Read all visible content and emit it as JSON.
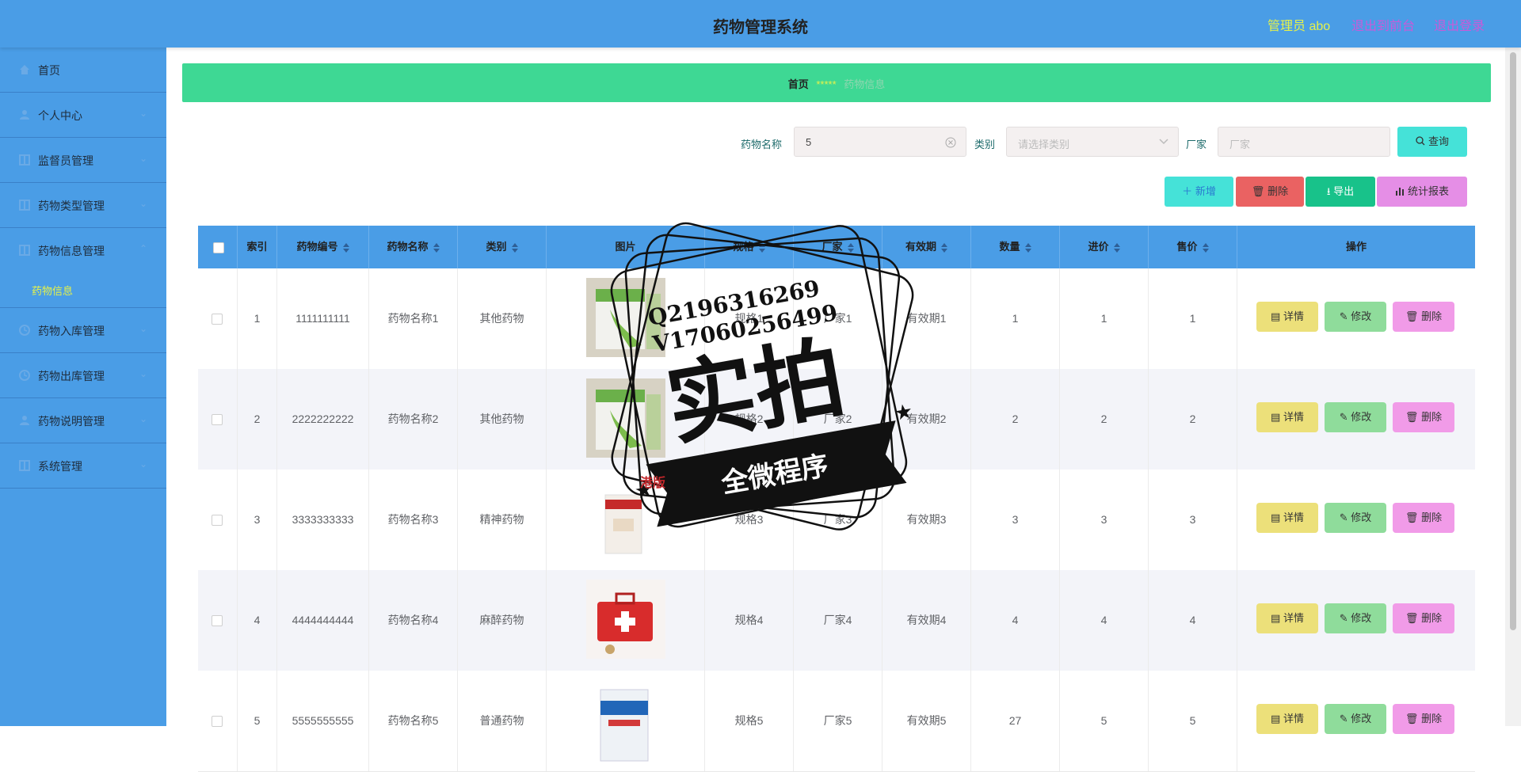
{
  "header": {
    "title": "药物管理系统",
    "admin": "管理员 abo",
    "back_to_front": "退出到前台",
    "logout": "退出登录"
  },
  "sidebar": {
    "items": [
      {
        "label": "首页",
        "icon": "home-icon",
        "chevron": ""
      },
      {
        "label": "个人中心",
        "icon": "user-icon",
        "chevron": "⌄"
      },
      {
        "label": "监督员管理",
        "icon": "grid-icon",
        "chevron": "⌄"
      },
      {
        "label": "药物类型管理",
        "icon": "grid-icon",
        "chevron": "⌄"
      },
      {
        "label": "药物信息管理",
        "icon": "grid-icon",
        "chevron": "⌃"
      },
      {
        "label": "药物入库管理",
        "icon": "clock-icon",
        "chevron": "⌄"
      },
      {
        "label": "药物出库管理",
        "icon": "clock-icon",
        "chevron": "⌄"
      },
      {
        "label": "药物说明管理",
        "icon": "user-icon",
        "chevron": "⌄"
      },
      {
        "label": "系统管理",
        "icon": "grid-icon",
        "chevron": "⌄"
      }
    ],
    "sub_item": "药物信息"
  },
  "breadcrumb": {
    "home": "首页",
    "sep": "*****",
    "current": "药物信息"
  },
  "search": {
    "name_label": "药物名称",
    "name_value": "5",
    "category_label": "类别",
    "category_placeholder": "请选择类别",
    "vendor_label": "厂家",
    "vendor_placeholder": "厂家",
    "query_button": "查询"
  },
  "toolbar": {
    "add": "新增",
    "delete": "删除",
    "export": "导出",
    "report": "统计报表"
  },
  "table": {
    "headers": [
      "索引",
      "药物编号",
      "药物名称",
      "类别",
      "图片",
      "规格",
      "厂家",
      "有效期",
      "数量",
      "进价",
      "售价",
      "操作"
    ],
    "rows": [
      {
        "idx": "1",
        "code": "1111111111",
        "name": "药物名称1",
        "category": "其他药物",
        "spec": "规格1",
        "vendor": "厂家1",
        "expiry": "有效期1",
        "qty": "1",
        "cost": "1",
        "price": "1"
      },
      {
        "idx": "2",
        "code": "2222222222",
        "name": "药物名称2",
        "category": "其他药物",
        "spec": "规格2",
        "vendor": "厂家2",
        "expiry": "有效期2",
        "qty": "2",
        "cost": "2",
        "price": "2"
      },
      {
        "idx": "3",
        "code": "3333333333",
        "name": "药物名称3",
        "category": "精神药物",
        "spec": "规格3",
        "vendor": "厂家3",
        "expiry": "有效期3",
        "qty": "3",
        "cost": "3",
        "price": "3"
      },
      {
        "idx": "4",
        "code": "4444444444",
        "name": "药物名称4",
        "category": "麻醉药物",
        "spec": "规格4",
        "vendor": "厂家4",
        "expiry": "有效期4",
        "qty": "4",
        "cost": "4",
        "price": "4"
      },
      {
        "idx": "5",
        "code": "5555555555",
        "name": "药物名称5",
        "category": "普通药物",
        "spec": "规格5",
        "vendor": "厂家5",
        "expiry": "有效期5",
        "qty": "27",
        "cost": "5",
        "price": "5"
      }
    ],
    "actions": {
      "detail": "详情",
      "edit": "修改",
      "delete": "删除"
    }
  },
  "watermark": {
    "line1": "Q2196316269",
    "line2": "V17060256499",
    "main": "实拍",
    "ribbon": "全微程序",
    "corner": "港版"
  },
  "colors": {
    "header_bg": "#4a9de6",
    "banner_bg": "#3ed894",
    "admin_text": "#e6f24a",
    "link_text": "#c95ad9",
    "btn_add": "#45e2d8",
    "btn_delete": "#ea6262",
    "btn_export": "#18c28a",
    "btn_report": "#e58ee6",
    "btn_detail": "#ece07a",
    "btn_edit": "#8fdc9b",
    "btn_row_delete": "#f19be8"
  }
}
